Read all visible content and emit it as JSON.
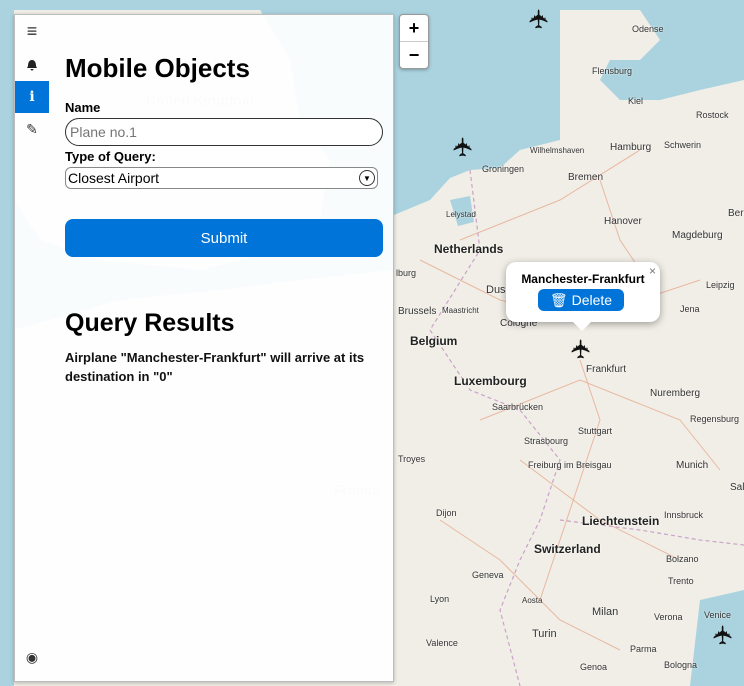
{
  "sidebar": {
    "tabs": [
      {
        "icon": "hamburger-icon",
        "glyph": "≡"
      },
      {
        "icon": "bell-icon",
        "glyph": "🔔"
      },
      {
        "icon": "info-icon",
        "glyph": "i"
      },
      {
        "icon": "edit-icon",
        "glyph": "✎"
      }
    ],
    "github_glyph": "◉",
    "title": "Mobile Objects",
    "name_label": "Name",
    "name_placeholder": "Plane no.1",
    "query_label": "Type of Query:",
    "query_selected": "Closest Airport",
    "submit_label": "Submit",
    "results_title": "Query Results",
    "result_text": "Airplane \"Manchester-Frankfurt\" will arrive at its destination in \"0\""
  },
  "map": {
    "zoom_in": "+",
    "zoom_out": "−",
    "labels": [
      {
        "name": "United Kingdom",
        "text": "United Kingdom"
      },
      {
        "name": "Odense",
        "text": "Odense"
      },
      {
        "name": "Flensburg",
        "text": "Flensburg"
      },
      {
        "name": "Kiel",
        "text": "Kiel"
      },
      {
        "name": "Rostock",
        "text": "Rostock"
      },
      {
        "name": "Wilhelmshaven",
        "text": "Wilhelmshaven"
      },
      {
        "name": "Hamburg",
        "text": "Hamburg"
      },
      {
        "name": "Schwerin",
        "text": "Schwerin"
      },
      {
        "name": "Groningen",
        "text": "Groningen"
      },
      {
        "name": "Bremen",
        "text": "Bremen"
      },
      {
        "name": "Lelystad",
        "text": "Lelystad"
      },
      {
        "name": "Hanover",
        "text": "Hanover"
      },
      {
        "name": "Magdeburg",
        "text": "Magdeburg"
      },
      {
        "name": "Netherlands",
        "text": "Netherlands"
      },
      {
        "name": "Brussels",
        "text": "Brussels"
      },
      {
        "name": "Maastricht",
        "text": "Maastricht"
      },
      {
        "name": "Cologne",
        "text": "Cologne"
      },
      {
        "name": "Leipzig",
        "text": "Leipzig"
      },
      {
        "name": "Jena",
        "text": "Jena"
      },
      {
        "name": "Belgium",
        "text": "Belgium"
      },
      {
        "name": "Frankfurt",
        "text": "Frankfurt"
      },
      {
        "name": "Luxembourg",
        "text": "Luxembourg"
      },
      {
        "name": "Saarbrucken",
        "text": "Saarbrücken"
      },
      {
        "name": "Nuremberg",
        "text": "Nuremberg"
      },
      {
        "name": "Regensburg",
        "text": "Regensburg"
      },
      {
        "name": "Stuttgart",
        "text": "Stuttgart"
      },
      {
        "name": "Strasbourg",
        "text": "Strasbourg"
      },
      {
        "name": "Troyes",
        "text": "Troyes"
      },
      {
        "name": "Freiburg",
        "text": "Freiburg im Breisgau"
      },
      {
        "name": "Munich",
        "text": "Munich"
      },
      {
        "name": "France",
        "text": "France"
      },
      {
        "name": "Dijon",
        "text": "Dijon"
      },
      {
        "name": "Liechtenstein",
        "text": "Liechtenstein"
      },
      {
        "name": "Innsbruck",
        "text": "Innsbruck"
      },
      {
        "name": "Switzerland",
        "text": "Switzerland"
      },
      {
        "name": "Bolzano",
        "text": "Bolzano"
      },
      {
        "name": "Geneva",
        "text": "Geneva"
      },
      {
        "name": "Trento",
        "text": "Trento"
      },
      {
        "name": "Lyon",
        "text": "Lyon"
      },
      {
        "name": "Aosta",
        "text": "Aosta"
      },
      {
        "name": "Milan",
        "text": "Milan"
      },
      {
        "name": "Verona",
        "text": "Verona"
      },
      {
        "name": "Venice",
        "text": "Venice"
      },
      {
        "name": "Turin",
        "text": "Turin"
      },
      {
        "name": "Parma",
        "text": "Parma"
      },
      {
        "name": "Valence",
        "text": "Valence"
      },
      {
        "name": "Genoa",
        "text": "Genoa"
      },
      {
        "name": "Bologna",
        "text": "Bologna"
      },
      {
        "name": "Dus",
        "text": "Dus"
      },
      {
        "name": "lburg",
        "text": "lburg"
      },
      {
        "name": "Ber",
        "text": "Ber"
      },
      {
        "name": "Sal",
        "text": "Sal"
      }
    ],
    "popup": {
      "title": "Manchester-Frankfurt",
      "close": "×",
      "delete_label": "🗑 Delete"
    },
    "plane_glyph": "✈"
  },
  "colors": {
    "accent": "#0074d9",
    "sea": "#aad3df",
    "land": "#f2efe9"
  }
}
